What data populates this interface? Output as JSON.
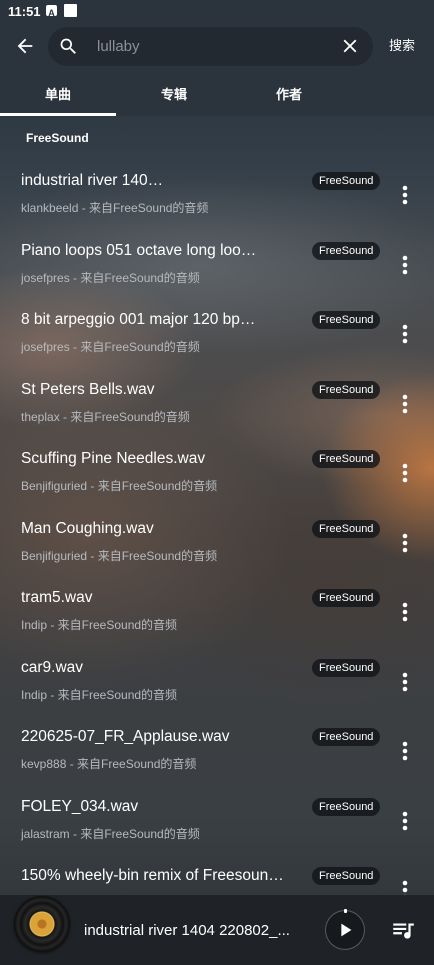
{
  "status_bar": {
    "time": "11:51",
    "icons": [
      "text-a-notification-icon",
      "square-notification-icon"
    ]
  },
  "header": {
    "back_icon": "arrow-left-icon",
    "search": {
      "icon": "search-icon",
      "placeholder": "lullaby",
      "clear_icon": "close-icon"
    },
    "search_button_label": "搜索"
  },
  "tabs": [
    {
      "label": "单曲",
      "active": true
    },
    {
      "label": "专辑",
      "active": false
    },
    {
      "label": "作者",
      "active": false
    }
  ],
  "section": {
    "title": "FreeSound"
  },
  "results": [
    {
      "title": "industrial river 140…",
      "subtitle": "klankbeeld - 来自FreeSound的音频",
      "badge": "FreeSound"
    },
    {
      "title": "Piano loops 051 octave long loo…",
      "subtitle": "josefpres - 来自FreeSound的音频",
      "badge": "FreeSound"
    },
    {
      "title": "8 bit arpeggio 001 major 120 bp…",
      "subtitle": "josefpres - 来自FreeSound的音频",
      "badge": "FreeSound"
    },
    {
      "title": "St Peters Bells.wav",
      "subtitle": "theplax - 来自FreeSound的音频",
      "badge": "FreeSound"
    },
    {
      "title": "Scuffing Pine Needles.wav",
      "subtitle": "Benjifiguried - 来自FreeSound的音频",
      "badge": "FreeSound"
    },
    {
      "title": "Man Coughing.wav",
      "subtitle": "Benjifiguried - 来自FreeSound的音频",
      "badge": "FreeSound"
    },
    {
      "title": "tram5.wav",
      "subtitle": "Indip - 来自FreeSound的音频",
      "badge": "FreeSound"
    },
    {
      "title": "car9.wav",
      "subtitle": "Indip - 来自FreeSound的音频",
      "badge": "FreeSound"
    },
    {
      "title": "220625-07_FR_Applause.wav",
      "subtitle": "kevp888 - 来自FreeSound的音频",
      "badge": "FreeSound"
    },
    {
      "title": "FOLEY_034.wav",
      "subtitle": "jalastram - 来自FreeSound的音频",
      "badge": "FreeSound"
    },
    {
      "title": "150% wheely-bin remix of Freesoun…",
      "subtitle": "",
      "badge": "FreeSound"
    }
  ],
  "row_more_icon": "more-vertical-icon",
  "player": {
    "cover_icon": "vinyl-record-icon",
    "title": "industrial river 1404 220802_...",
    "play_icon": "play-icon",
    "playlist_icon": "queue-music-icon"
  },
  "colors": {
    "header_bg": "#2b333d",
    "search_bg": "#222931",
    "badge_bg": "#15181c",
    "player_bg": "#1f2327",
    "text_primary": "#ffffff",
    "text_secondary": "#b6babf",
    "placeholder": "#8c9198"
  }
}
